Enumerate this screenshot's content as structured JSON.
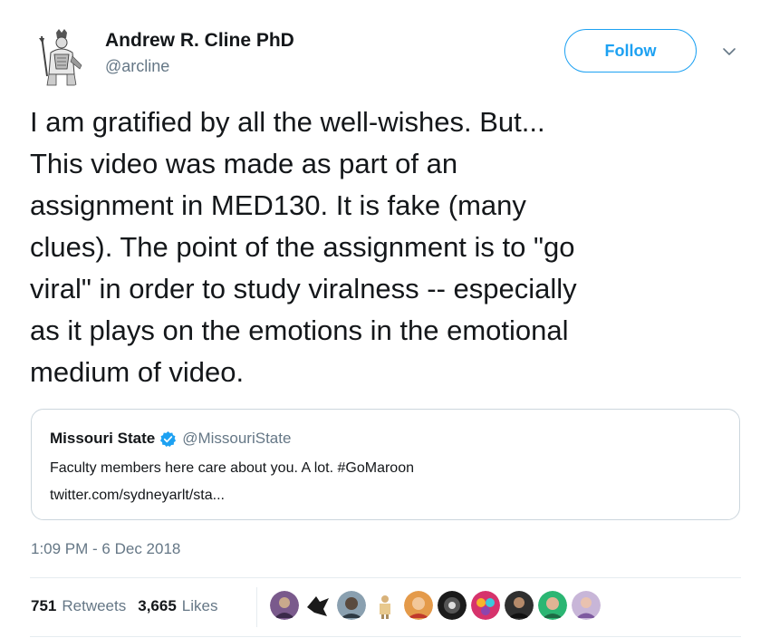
{
  "tweet": {
    "author": {
      "display_name": "Andrew R. Cline PhD",
      "handle": "@arcline",
      "avatar": "knight-figure-illustration"
    },
    "follow_label": "Follow",
    "menu_icon": "chevron-down-icon",
    "text": "I am gratified by all the well-wishes. But...\nThis video was made as part of an\nassignment in MED130. It is fake (many\nclues). The point of the assignment is to \"go\nviral\" in order to study viralness -- especially\nas it plays on the emotions in the emotional\nmedium of video.",
    "quote": {
      "name": "Missouri State",
      "verified_icon": "verified-badge-icon",
      "handle": "@MissouriState",
      "text": "Faculty members here care about you. A lot. #GoMaroon",
      "link": "twitter.com/sydneyarlt/sta..."
    },
    "timestamp": "1:09 PM - 6 Dec 2018",
    "stats": {
      "retweets_count": "751",
      "retweets_label": "Retweets",
      "likes_count": "3,665",
      "likes_label": "Likes"
    },
    "liker_avatars_count": 10
  },
  "colors": {
    "accent": "#1da1f2",
    "muted_text": "#657786",
    "text": "#14171a",
    "border": "#ccd6dd"
  }
}
